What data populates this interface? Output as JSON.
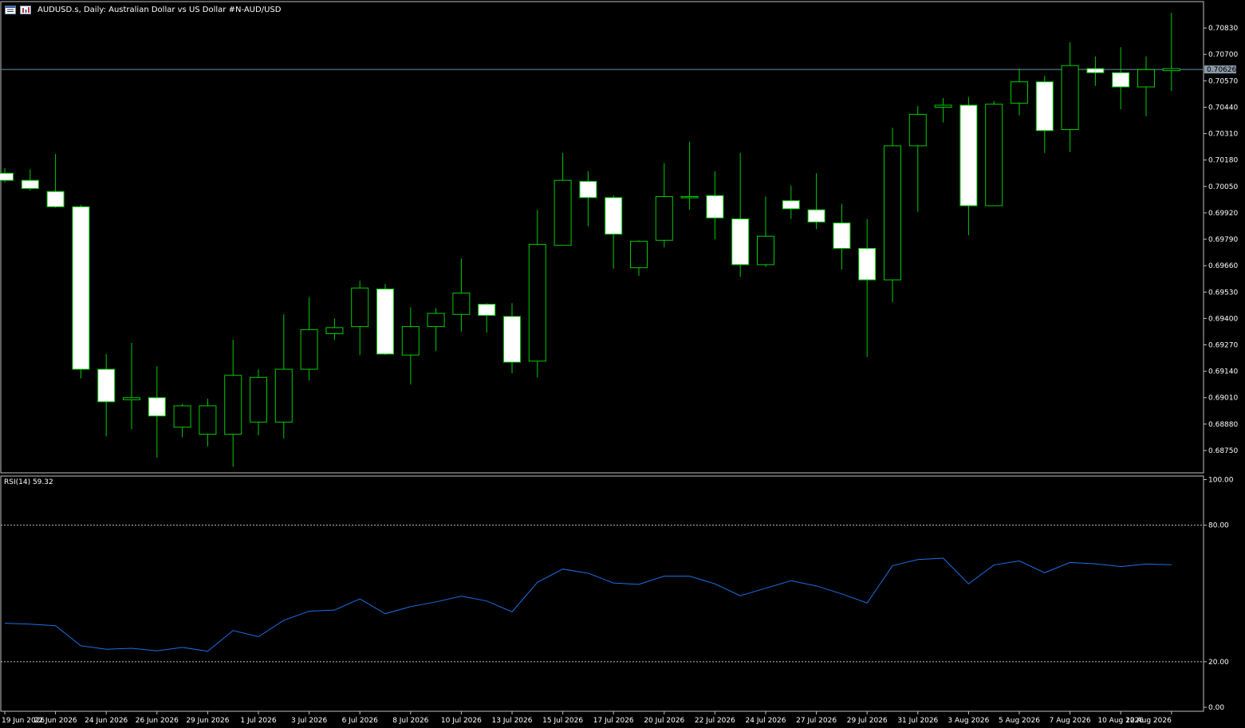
{
  "header": {
    "title": "AUDUSD.s, Daily:  Australian Dollar vs US Dollar #N-AUD/USD",
    "icons": [
      "window-list-icon",
      "chart-bars-icon"
    ]
  },
  "rsi": {
    "label": "RSI(14) 59.32",
    "period": 14,
    "current": 59.32,
    "levels": [
      20,
      80
    ],
    "scale_labels": [
      "100.00",
      "80.00",
      "20.00",
      "0.00"
    ]
  },
  "price_axis": {
    "ticks": [
      "0.70830",
      "0.70700",
      "0.70570",
      "0.70440",
      "0.70310",
      "0.70180",
      "0.70050",
      "0.69920",
      "0.69790",
      "0.69660",
      "0.69530",
      "0.69400",
      "0.69270",
      "0.69140",
      "0.69010",
      "0.68880",
      "0.68750"
    ],
    "current_price_label": "0.70626"
  },
  "time_axis": {
    "labels": [
      "19 Jun 2026",
      "22 Jun 2026",
      "24 Jun 2026",
      "26 Jun 2026",
      "29 Jun 2026",
      "1 Jul 2026",
      "3 Jul 2026",
      "6 Jul 2026",
      "8 Jul 2026",
      "10 Jul 2026",
      "13 Jul 2026",
      "15 Jul 2026",
      "17 Jul 2026",
      "20 Jul 2026",
      "22 Jul 2026",
      "24 Jul 2026",
      "27 Jul 2026",
      "29 Jul 2026",
      "31 Jul 2026",
      "3 Aug 2026",
      "5 Aug 2026",
      "7 Aug 2026",
      "10 Aug 2026",
      "12 Aug 2026"
    ]
  },
  "colors": {
    "background": "#000000",
    "wick": "#00cc00",
    "bar_fill": "#ffffff",
    "rsi_line": "#1e6fe8",
    "axis": "#c0c0c0",
    "current_price_line": "#7090a8",
    "level_line": "#c0c0c0"
  },
  "chart_data": [
    {
      "type": "candlestick",
      "symbol": "AUDUSD.s",
      "timeframe": "Daily",
      "ylim": [
        0.6864,
        0.7096
      ],
      "candles": [
        {
          "o": 0.70115,
          "h": 0.7014,
          "l": 0.7007,
          "c": 0.7008
        },
        {
          "o": 0.7008,
          "h": 0.70135,
          "l": 0.7003,
          "c": 0.7004
        },
        {
          "o": 0.70025,
          "h": 0.7021,
          "l": 0.69945,
          "c": 0.6995
        },
        {
          "o": 0.6995,
          "h": 0.6996,
          "l": 0.69105,
          "c": 0.6915
        },
        {
          "o": 0.6915,
          "h": 0.69225,
          "l": 0.6882,
          "c": 0.6899
        },
        {
          "o": 0.69,
          "h": 0.6928,
          "l": 0.68855,
          "c": 0.6901
        },
        {
          "o": 0.6901,
          "h": 0.69165,
          "l": 0.68715,
          "c": 0.6892
        },
        {
          "o": 0.68865,
          "h": 0.6898,
          "l": 0.68815,
          "c": 0.6897
        },
        {
          "o": 0.6883,
          "h": 0.69005,
          "l": 0.6877,
          "c": 0.6897
        },
        {
          "o": 0.6883,
          "h": 0.69295,
          "l": 0.6867,
          "c": 0.6912
        },
        {
          "o": 0.6889,
          "h": 0.6915,
          "l": 0.68825,
          "c": 0.6911
        },
        {
          "o": 0.6889,
          "h": 0.6942,
          "l": 0.6881,
          "c": 0.6915
        },
        {
          "o": 0.6915,
          "h": 0.69505,
          "l": 0.69095,
          "c": 0.69345
        },
        {
          "o": 0.69325,
          "h": 0.694,
          "l": 0.69295,
          "c": 0.69355
        },
        {
          "o": 0.6936,
          "h": 0.69585,
          "l": 0.6922,
          "c": 0.6955
        },
        {
          "o": 0.69545,
          "h": 0.6957,
          "l": 0.6922,
          "c": 0.69225
        },
        {
          "o": 0.6922,
          "h": 0.69455,
          "l": 0.69075,
          "c": 0.6936
        },
        {
          "o": 0.6936,
          "h": 0.6945,
          "l": 0.6924,
          "c": 0.69425
        },
        {
          "o": 0.6942,
          "h": 0.69695,
          "l": 0.69335,
          "c": 0.69525
        },
        {
          "o": 0.6947,
          "h": 0.69475,
          "l": 0.6933,
          "c": 0.69415
        },
        {
          "o": 0.6941,
          "h": 0.69475,
          "l": 0.6913,
          "c": 0.69185
        },
        {
          "o": 0.6919,
          "h": 0.69935,
          "l": 0.6911,
          "c": 0.69765
        },
        {
          "o": 0.6976,
          "h": 0.70215,
          "l": 0.6976,
          "c": 0.7008
        },
        {
          "o": 0.70075,
          "h": 0.70125,
          "l": 0.69855,
          "c": 0.69995
        },
        {
          "o": 0.69995,
          "h": 0.70005,
          "l": 0.69645,
          "c": 0.69815
        },
        {
          "o": 0.6965,
          "h": 0.69785,
          "l": 0.6961,
          "c": 0.6978
        },
        {
          "o": 0.69785,
          "h": 0.70165,
          "l": 0.6975,
          "c": 0.7
        },
        {
          "o": 0.69995,
          "h": 0.7027,
          "l": 0.69935,
          "c": 0.7
        },
        {
          "o": 0.70005,
          "h": 0.70125,
          "l": 0.6979,
          "c": 0.69895
        },
        {
          "o": 0.6989,
          "h": 0.70215,
          "l": 0.69605,
          "c": 0.69665
        },
        {
          "o": 0.69665,
          "h": 0.7,
          "l": 0.69655,
          "c": 0.69805
        },
        {
          "o": 0.6998,
          "h": 0.70055,
          "l": 0.6989,
          "c": 0.6994
        },
        {
          "o": 0.69935,
          "h": 0.70115,
          "l": 0.6984,
          "c": 0.69875
        },
        {
          "o": 0.6987,
          "h": 0.69965,
          "l": 0.6964,
          "c": 0.69745
        },
        {
          "o": 0.69745,
          "h": 0.6989,
          "l": 0.6921,
          "c": 0.6959
        },
        {
          "o": 0.6959,
          "h": 0.7034,
          "l": 0.6948,
          "c": 0.7025
        },
        {
          "o": 0.7025,
          "h": 0.70445,
          "l": 0.69925,
          "c": 0.70405
        },
        {
          "o": 0.7044,
          "h": 0.70485,
          "l": 0.70365,
          "c": 0.7045
        },
        {
          "o": 0.7045,
          "h": 0.7049,
          "l": 0.6981,
          "c": 0.69955
        },
        {
          "o": 0.69955,
          "h": 0.7047,
          "l": 0.69955,
          "c": 0.70455
        },
        {
          "o": 0.7046,
          "h": 0.7063,
          "l": 0.704,
          "c": 0.70565
        },
        {
          "o": 0.70565,
          "h": 0.70595,
          "l": 0.70215,
          "c": 0.70325
        },
        {
          "o": 0.7033,
          "h": 0.7076,
          "l": 0.7022,
          "c": 0.70645
        },
        {
          "o": 0.7063,
          "h": 0.7069,
          "l": 0.70545,
          "c": 0.7061
        },
        {
          "o": 0.7061,
          "h": 0.70735,
          "l": 0.7043,
          "c": 0.7054
        },
        {
          "o": 0.7054,
          "h": 0.7069,
          "l": 0.70395,
          "c": 0.70625
        },
        {
          "o": 0.7062,
          "h": 0.70905,
          "l": 0.7052,
          "c": 0.7063
        }
      ]
    },
    {
      "type": "line",
      "name": "RSI(14)",
      "ylim": [
        0,
        100
      ],
      "values": [
        36.9,
        36.5,
        35.8,
        27.0,
        25.5,
        25.9,
        24.8,
        26.3,
        24.6,
        33.7,
        31.0,
        38.2,
        42.2,
        42.7,
        47.6,
        41.1,
        44.2,
        46.3,
        48.8,
        46.7,
        41.9,
        54.9,
        60.7,
        58.9,
        54.6,
        54.0,
        57.6,
        57.6,
        54.2,
        49.0,
        52.3,
        55.6,
        53.3,
        49.8,
        45.8,
        62.2,
        64.9,
        65.5,
        54.2,
        62.5,
        64.3,
        59.1,
        63.6,
        63.0,
        61.8,
        62.9,
        62.6
      ]
    }
  ]
}
